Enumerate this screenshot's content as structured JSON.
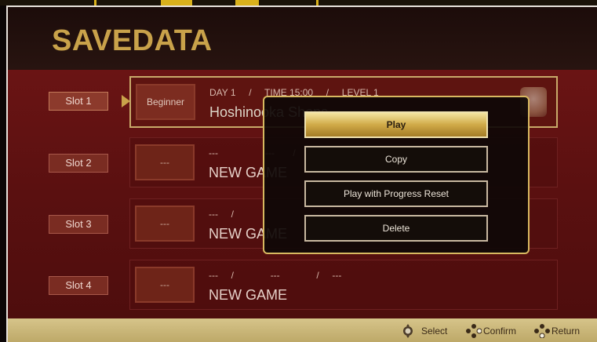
{
  "title": "SAVEDATA",
  "slots": [
    {
      "label": "Slot 1",
      "badge": "Beginner",
      "day": "DAY 1",
      "time": "TIME 15:00",
      "level": "LEVEL 1",
      "location": "Hoshinooka Shops"
    },
    {
      "label": "Slot 2",
      "badge": "---",
      "day": "---",
      "time": "---",
      "level": "",
      "location": "NEW GAME"
    },
    {
      "label": "Slot 3",
      "badge": "---",
      "day": "---",
      "time": "",
      "level": "",
      "location": "NEW GAME"
    },
    {
      "label": "Slot 4",
      "badge": "---",
      "day": "---",
      "time": "---",
      "level": "---",
      "location": "NEW GAME"
    }
  ],
  "dialog": {
    "options": [
      "Play",
      "Copy",
      "Play with Progress Reset",
      "Delete"
    ],
    "selected_index": 0
  },
  "footer": {
    "select": "Select",
    "confirm": "Confirm",
    "return": "Return"
  },
  "colors": {
    "accent_gold": "#c9a24a",
    "background_red": "#5a0f0f",
    "footer": "#c9b574"
  }
}
